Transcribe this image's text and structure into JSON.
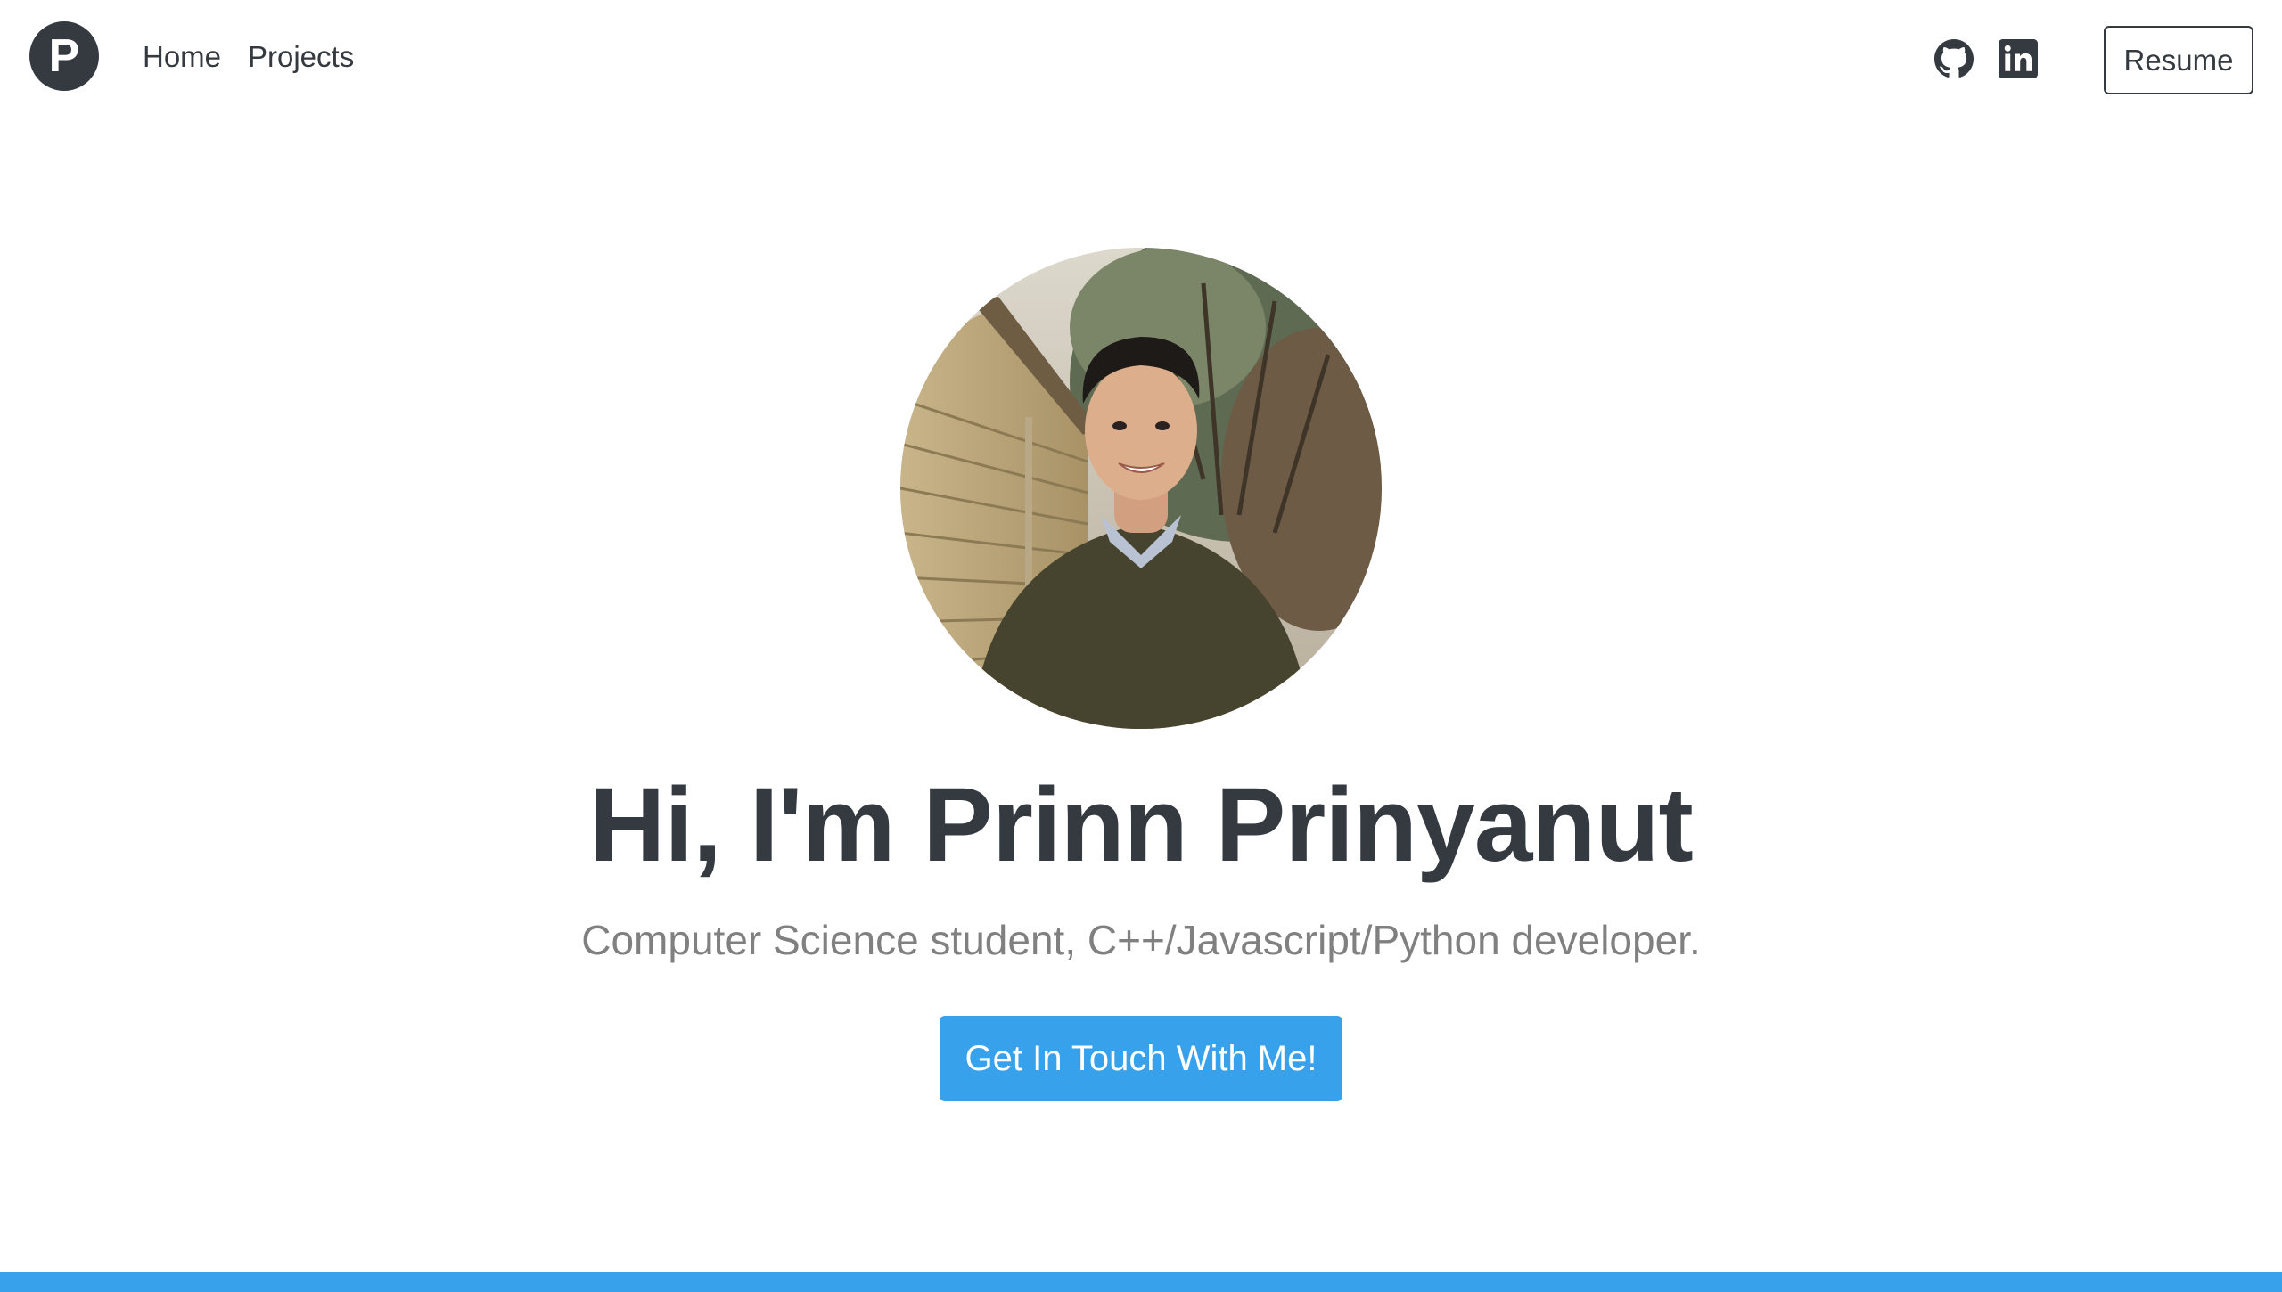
{
  "nav": {
    "logo_letter": "P",
    "links": [
      {
        "label": "Home"
      },
      {
        "label": "Projects"
      }
    ],
    "icons": [
      "github-icon",
      "linkedin-icon"
    ],
    "resume_label": "Resume"
  },
  "hero": {
    "headline": "Hi, I'm Prinn Prinyanut",
    "subtitle": "Computer Science student, C++/Javascript/Python developer.",
    "cta_label": "Get In Touch With Me!"
  },
  "colors": {
    "text": "#343a40",
    "accent": "#37a2eb",
    "muted": "#808080",
    "background": "#ffffff"
  }
}
